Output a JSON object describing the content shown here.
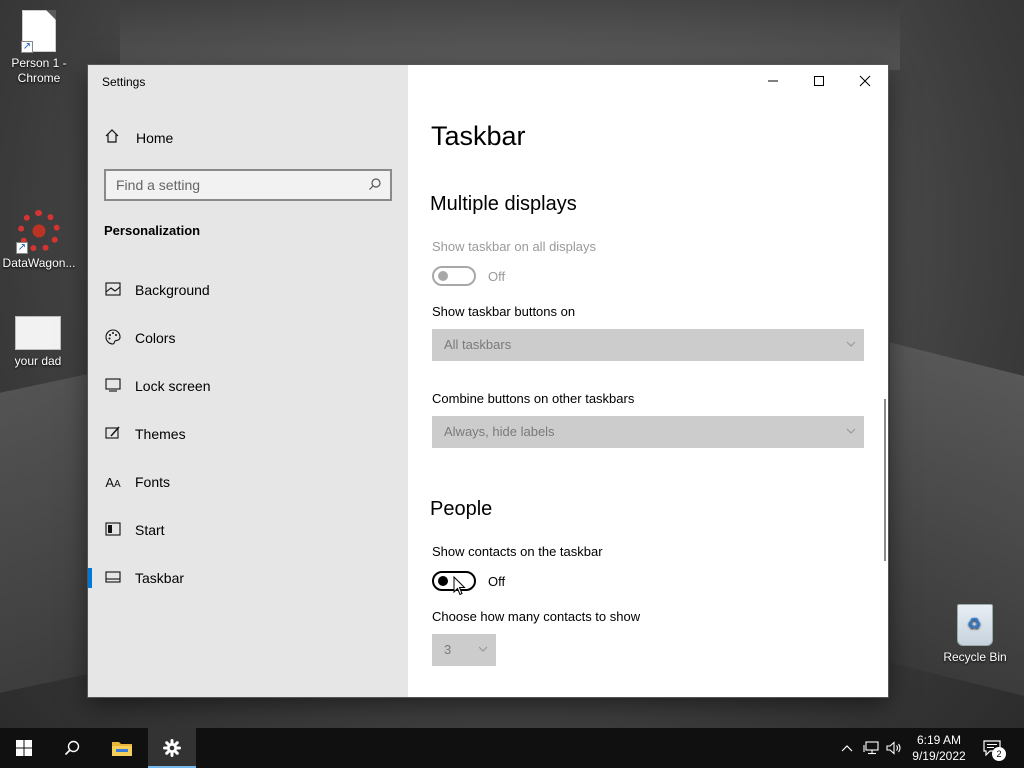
{
  "desktop": {
    "icons": [
      {
        "label": "Person 1 - Chrome",
        "icon": "document-shortcut-icon"
      },
      {
        "label": "DataWagon...",
        "icon": "gear-shortcut-icon"
      },
      {
        "label": "your dad",
        "icon": "image-icon"
      },
      {
        "label": "Recycle Bin",
        "icon": "recycle-bin-icon"
      }
    ]
  },
  "window": {
    "title": "Settings",
    "controls": {
      "minimize": "minimize-icon",
      "maximize": "maximize-icon",
      "close": "close-icon"
    }
  },
  "sidebar": {
    "home_label": "Home",
    "search_placeholder": "Find a setting",
    "section": "Personalization",
    "items": [
      {
        "label": "Background",
        "icon": "background-icon"
      },
      {
        "label": "Colors",
        "icon": "palette-icon"
      },
      {
        "label": "Lock screen",
        "icon": "lock-screen-icon"
      },
      {
        "label": "Themes",
        "icon": "themes-icon"
      },
      {
        "label": "Fonts",
        "icon": "fonts-icon"
      },
      {
        "label": "Start",
        "icon": "start-icon"
      },
      {
        "label": "Taskbar",
        "icon": "taskbar-icon",
        "active": true
      }
    ]
  },
  "content": {
    "title": "Taskbar",
    "multiple_displays": {
      "heading": "Multiple displays",
      "show_all_label": "Show taskbar on all displays",
      "show_all_state": "Off",
      "buttons_on_label": "Show taskbar buttons on",
      "buttons_on_value": "All taskbars",
      "combine_label": "Combine buttons on other taskbars",
      "combine_value": "Always, hide labels"
    },
    "people": {
      "heading": "People",
      "show_contacts_label": "Show contacts on the taskbar",
      "show_contacts_state": "Off",
      "how_many_label": "Choose how many contacts to show",
      "how_many_value": "3"
    }
  },
  "taskbar": {
    "clock_time": "6:19 AM",
    "clock_date": "9/19/2022",
    "notification_count": "2"
  },
  "colors": {
    "accent": "#0078d7",
    "sidebar_bg": "#e6e6e6",
    "taskbar_bg": "#101010",
    "disabled_text": "#9a9a9a"
  }
}
